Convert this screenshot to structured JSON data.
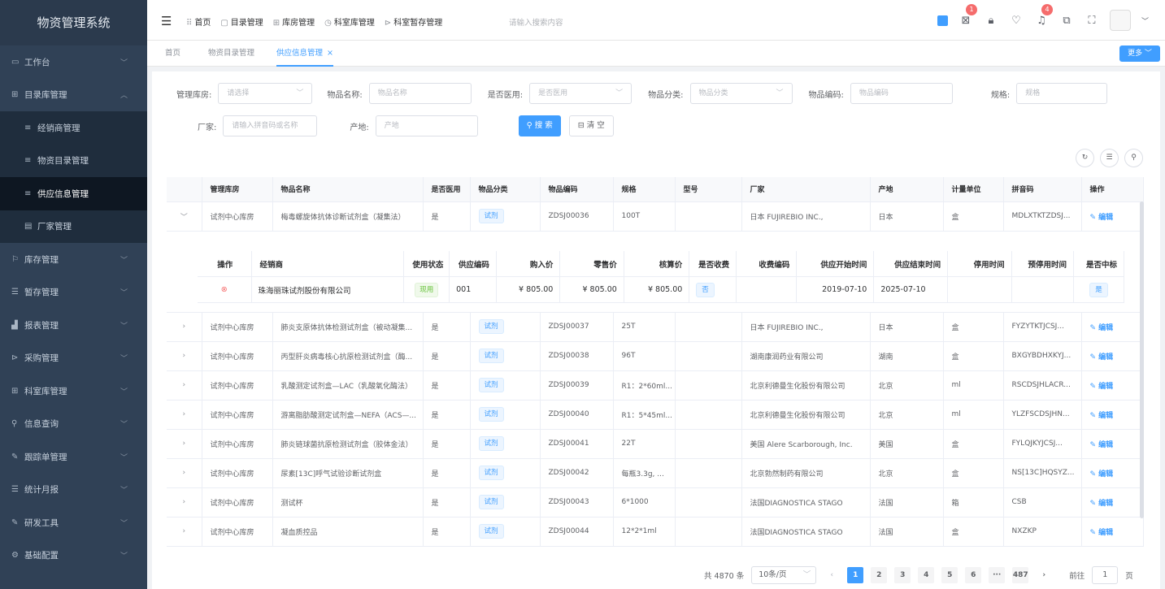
{
  "sidebar": {
    "title": "物资管理系统",
    "items": [
      {
        "label": "工作台",
        "icon": "monitor-icon",
        "glyph": "▭",
        "chev": "﹀"
      },
      {
        "label": "目录库管理",
        "icon": "grid-icon",
        "glyph": "⊞",
        "chev": "︿"
      },
      {
        "label": "经销商管理",
        "icon": "list-icon",
        "glyph": "≡",
        "chev": ""
      },
      {
        "label": "物资目录管理",
        "icon": "list-icon",
        "glyph": "≡",
        "chev": ""
      },
      {
        "label": "供应信息管理",
        "icon": "list-icon",
        "glyph": "≡",
        "chev": ""
      },
      {
        "label": "厂家管理",
        "icon": "factory-icon",
        "glyph": "▤",
        "chev": ""
      },
      {
        "label": "库存管理",
        "icon": "flag-icon",
        "glyph": "⚐",
        "chev": "﹀"
      },
      {
        "label": "暂存管理",
        "icon": "lines-icon",
        "glyph": "☰",
        "chev": "﹀"
      },
      {
        "label": "报表管理",
        "icon": "bar-chart-icon",
        "glyph": "▟",
        "chev": "﹀"
      },
      {
        "label": "采购管理",
        "icon": "send-icon",
        "glyph": "⊳",
        "chev": "﹀"
      },
      {
        "label": "科室库管理",
        "icon": "grid-icon",
        "glyph": "⊞",
        "chev": "﹀"
      },
      {
        "label": "信息查询",
        "icon": "search-icon",
        "glyph": "⚲",
        "chev": "﹀"
      },
      {
        "label": "跟踪单管理",
        "icon": "edit-icon",
        "glyph": "✎",
        "chev": "﹀"
      },
      {
        "label": "统计月报",
        "icon": "lines-icon",
        "glyph": "☰",
        "chev": "﹀"
      },
      {
        "label": "研发工具",
        "icon": "tool-icon",
        "glyph": "✎",
        "chev": "﹀"
      },
      {
        "label": "基础配置",
        "icon": "settings-icon",
        "glyph": "⚙",
        "chev": "﹀"
      }
    ]
  },
  "topbar": {
    "nav": [
      {
        "icon": "home-icon",
        "glyph": "⠿",
        "label": "首页"
      },
      {
        "icon": "catalog-icon",
        "glyph": "▢",
        "label": "目录管理"
      },
      {
        "icon": "warehouse-icon",
        "glyph": "⊞",
        "label": "库房管理"
      },
      {
        "icon": "dept-icon",
        "glyph": "◷",
        "label": "科室库管理"
      },
      {
        "icon": "storage-icon",
        "glyph": "⊳",
        "label": "科室暂存管理"
      }
    ],
    "search_placeholder": "请输入搜索内容",
    "badge_a": "1",
    "badge_b": "4"
  },
  "tabs": {
    "home": "首页",
    "catalog": "物资目录管理",
    "supply": "供应信息管理",
    "close": "×",
    "more": "更多 ﹀"
  },
  "filters": {
    "warehouse_label": "管理库房:",
    "warehouse_ph": "请选择",
    "name_label": "物品名称:",
    "name_ph": "物品名称",
    "medical_label": "是否医用:",
    "medical_ph": "是否医用",
    "category_label": "物品分类:",
    "category_ph": "物品分类",
    "code_label": "物品编码:",
    "code_ph": "物品编码",
    "spec_label": "规格:",
    "spec_ph": "规格",
    "vendor_label": "厂家:",
    "vendor_ph": "请输入拼音码或名称",
    "origin_label": "产地:",
    "origin_ph": "产地",
    "search_btn": "⚲ 搜 索",
    "clear_btn": "⊟ 清 空",
    "arrow": "﹀"
  },
  "tools": {
    "refresh": "↻",
    "columns": "☰",
    "search": "⚲"
  },
  "table": {
    "headers": [
      "",
      "管理库房",
      "物品名称",
      "是否医用",
      "物品分类",
      "物品编码",
      "规格",
      "型号",
      "厂家",
      "产地",
      "计量单位",
      "拼音码",
      "操作"
    ],
    "edit_label": "✎ 编辑",
    "rows": [
      {
        "exp": "﹀",
        "wh": "试剂中心库房",
        "name": "梅毒螺旋体抗体诊断试剂盒（凝集法）",
        "med": "是",
        "cat": "试剂",
        "code": "ZDSJ00036",
        "spec": "100T",
        "model": "",
        "vendor": "日本 FUJIREBIO INC.,",
        "origin": "日本",
        "unit": "盒",
        "py": "MDLXTKTZDSJ..."
      },
      {
        "exp": "›",
        "wh": "试剂中心库房",
        "name": "肺炎支原体抗体检测试剂盒（被动凝集...",
        "med": "是",
        "cat": "试剂",
        "code": "ZDSJ00037",
        "spec": "25T",
        "model": "",
        "vendor": "日本 FUJIREBIO INC.,",
        "origin": "日本",
        "unit": "盒",
        "py": "FYZYTKTJCSJ..."
      },
      {
        "exp": "›",
        "wh": "试剂中心库房",
        "name": "丙型肝炎病毒核心抗原检测试剂盒（酶...",
        "med": "是",
        "cat": "试剂",
        "code": "ZDSJ00038",
        "spec": "96T",
        "model": "",
        "vendor": "湖南康润药业有限公司",
        "origin": "湖南",
        "unit": "盒",
        "py": "BXGYBDHXKYJ..."
      },
      {
        "exp": "›",
        "wh": "试剂中心库房",
        "name": "乳酸测定试剂盒—LAC（乳酸氧化酶法）",
        "med": "是",
        "cat": "试剂",
        "code": "ZDSJ00039",
        "spec": "R1：2*60ml...",
        "model": "",
        "vendor": "北京利德曼生化股份有限公司",
        "origin": "北京",
        "unit": "ml",
        "py": "RSCDSJHLACR..."
      },
      {
        "exp": "›",
        "wh": "试剂中心库房",
        "name": "游离脂肪酸测定试剂盒—NEFA（ACS—...",
        "med": "是",
        "cat": "试剂",
        "code": "ZDSJ00040",
        "spec": "R1：5*45ml...",
        "model": "",
        "vendor": "北京利德曼生化股份有限公司",
        "origin": "北京",
        "unit": "ml",
        "py": "YLZFSCDSJHN..."
      },
      {
        "exp": "›",
        "wh": "试剂中心库房",
        "name": "肺炎链球菌抗原检测试剂盒（胶体金法）",
        "med": "是",
        "cat": "试剂",
        "code": "ZDSJ00041",
        "spec": "22T",
        "model": "",
        "vendor": "美国 Alere Scarborough, Inc.",
        "origin": "美国",
        "unit": "盒",
        "py": "FYLQJKYJCSJ..."
      },
      {
        "exp": "›",
        "wh": "试剂中心库房",
        "name": "尿素[13C]呼气试验诊断试剂盒",
        "med": "是",
        "cat": "试剂",
        "code": "ZDSJ00042",
        "spec": "每瓶3.3g, ...",
        "model": "",
        "vendor": "北京勃然制药有限公司",
        "origin": "北京",
        "unit": "盒",
        "py": "NS[13C]HQSYZ..."
      },
      {
        "exp": "›",
        "wh": "试剂中心库房",
        "name": "测试杯",
        "med": "是",
        "cat": "试剂",
        "code": "ZDSJ00043",
        "spec": "6*1000",
        "model": "",
        "vendor": "法国DIAGNOSTICA STAGO",
        "origin": "法国",
        "unit": "箱",
        "py": "CSB"
      },
      {
        "exp": "›",
        "wh": "试剂中心库房",
        "name": "凝血质控品",
        "med": "是",
        "cat": "试剂",
        "code": "ZDSJ00044",
        "spec": "12*2*1ml",
        "model": "",
        "vendor": "法国DIAGNOSTICA STAGO",
        "origin": "法国",
        "unit": "盒",
        "py": "NXZKP"
      }
    ],
    "sub": {
      "headers": [
        "操作",
        "经销商",
        "使用状态",
        "供应编码",
        "购入价",
        "零售价",
        "核算价",
        "是否收费",
        "收费编码",
        "供应开始时间",
        "供应结束时间",
        "停用时间",
        "预停用时间",
        "是否中标"
      ],
      "row": {
        "op": "⊗",
        "dealer": "珠海丽珠试剂股份有限公司",
        "status": "现用",
        "scode": "001",
        "buy": "¥ 805.00",
        "retail": "¥ 805.00",
        "acct": "¥ 805.00",
        "charge": "否",
        "ccode": "",
        "start": "2019-07-10",
        "end": "2025-07-10",
        "stop": "",
        "prestop": "",
        "bid": "是"
      }
    }
  },
  "pagination": {
    "total": "共 4870 条",
    "size": "10条/页",
    "size_arrow": "﹀",
    "prev": "‹",
    "pages": [
      "1",
      "2",
      "3",
      "4",
      "5",
      "6",
      "···",
      "487"
    ],
    "next": "›",
    "goto_label": "前往",
    "goto_value": "1",
    "page_unit": "页"
  }
}
